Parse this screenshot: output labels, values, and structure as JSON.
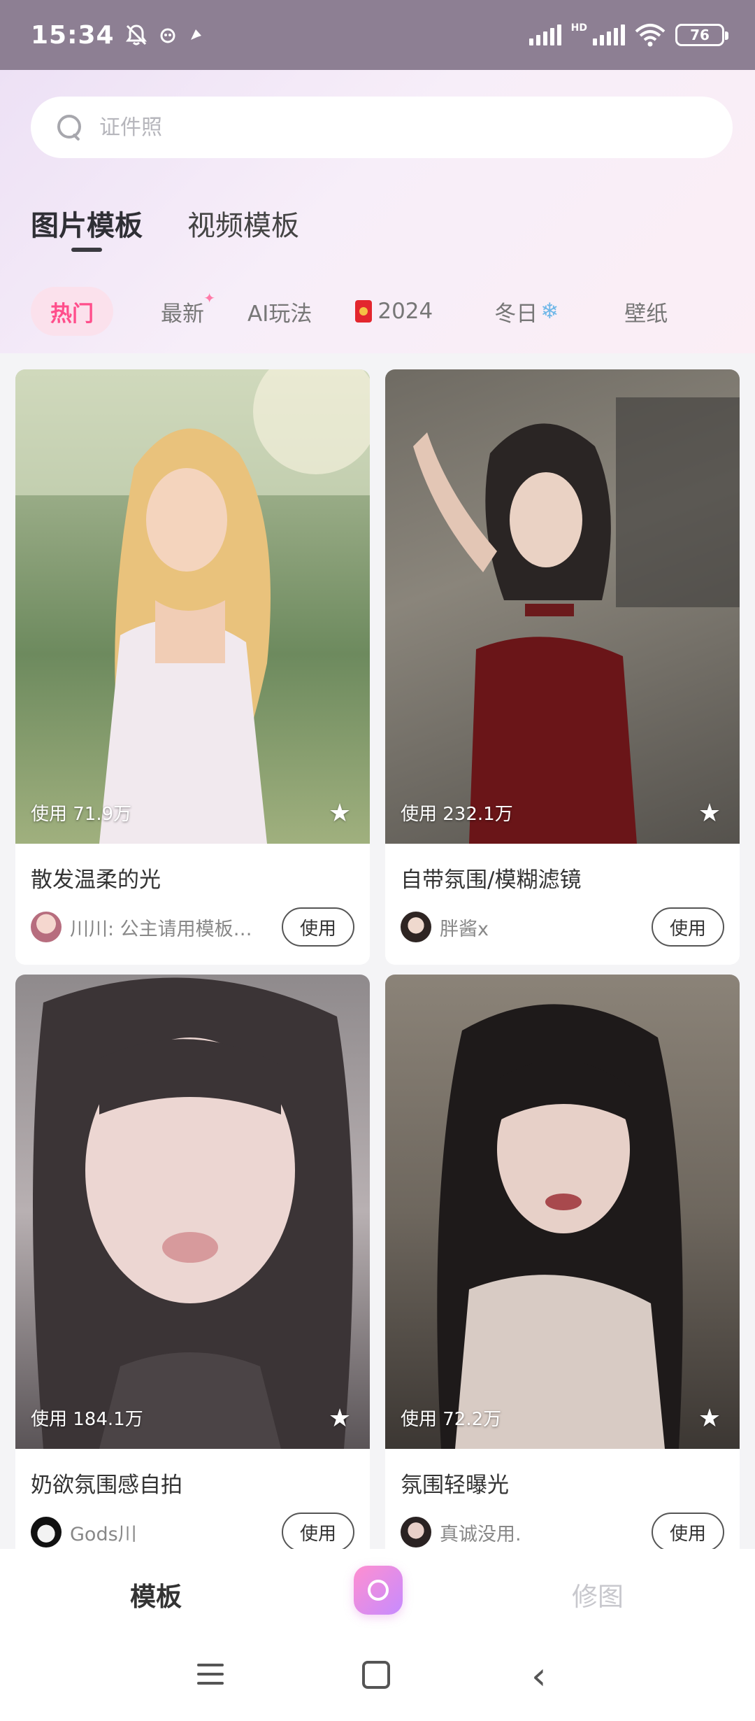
{
  "status_bar": {
    "time": "15:34",
    "network_label": "HD",
    "battery": "76",
    "icons": [
      "bell-off-icon",
      "app-notification-icon",
      "app-notification-icon",
      "signal-icon",
      "wifi-icon",
      "battery-icon"
    ]
  },
  "search": {
    "placeholder": "证件照"
  },
  "main_tabs": [
    {
      "label": "图片模板",
      "active": true
    },
    {
      "label": "视频模板",
      "active": false
    }
  ],
  "category_chips": [
    {
      "label": "热门",
      "active": true
    },
    {
      "label": "最新",
      "active": false
    },
    {
      "label": "AI玩法",
      "active": false
    },
    {
      "label": "2024",
      "active": false
    },
    {
      "label": "冬日",
      "active": false
    },
    {
      "label": "壁纸",
      "active": false
    }
  ],
  "cards": [
    {
      "usage": "使用 71.9万",
      "title": "散发温柔的光",
      "author": "川川: 公主请用模板…",
      "button": "使用"
    },
    {
      "usage": "使用 232.1万",
      "title": "自带氛围/模糊滤镜",
      "author": "胖酱x",
      "button": "使用"
    },
    {
      "usage": "使用 184.1万",
      "title": "奶欲氛围感自拍",
      "author": "Gods川",
      "button": "使用"
    },
    {
      "usage": "使用 72.2万",
      "title": "氛围轻曝光",
      "author": "真诚没用.",
      "button": "使用"
    }
  ],
  "bottom_nav": {
    "templates": "模板",
    "edit": "修图"
  },
  "colors": {
    "accent": "#ff4e8b",
    "status_bar_bg": "#8d7f93"
  }
}
